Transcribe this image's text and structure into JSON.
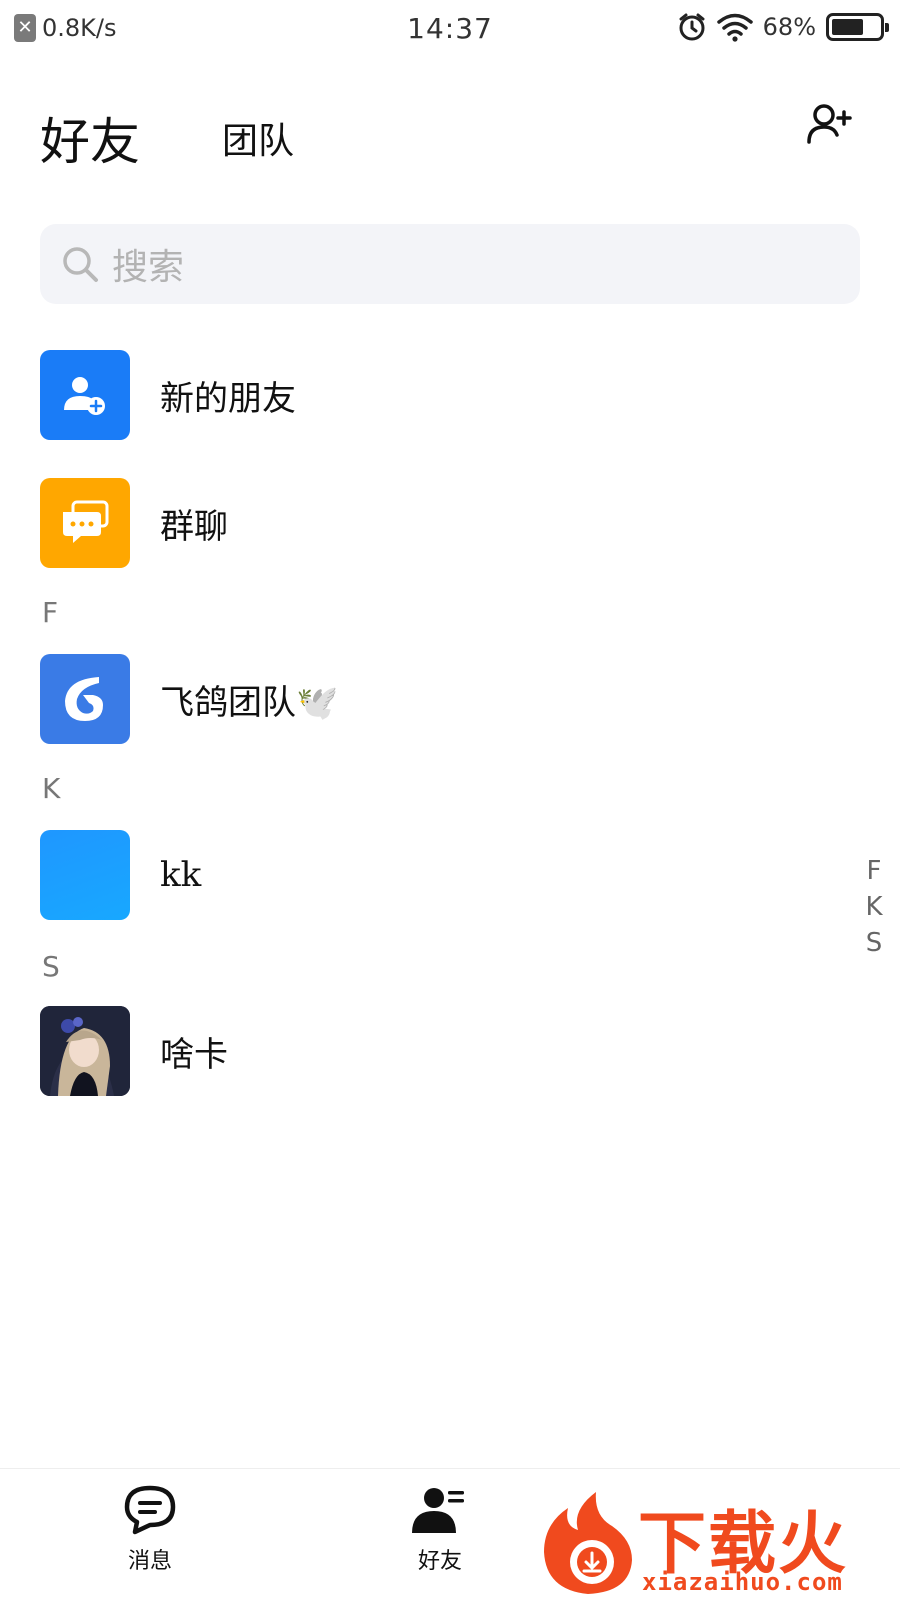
{
  "status_bar": {
    "network_speed": "0.8K/s",
    "close_glyph": "✕",
    "time": "14:37",
    "battery_percent": "68%",
    "battery_level": 0.68,
    "icons": [
      "alarm-icon",
      "wifi-icon",
      "battery-icon"
    ]
  },
  "header": {
    "tab_active": "好友",
    "tab_inactive": "团队",
    "add_friend_icon": "add-friend-icon"
  },
  "search": {
    "placeholder": "搜索",
    "icon": "search-icon"
  },
  "fixed_items": [
    {
      "label": "新的朋友",
      "icon": "new-friend-icon",
      "color": "#1a7cf7"
    },
    {
      "label": "群聊",
      "icon": "group-chat-icon",
      "color": "#ffa700"
    }
  ],
  "sections": [
    {
      "letter": "F",
      "contacts": [
        {
          "name": "飞鸽团队🕊️",
          "avatar": "feige-logo-icon",
          "color": "#3a7be6"
        }
      ]
    },
    {
      "letter": "K",
      "contacts": [
        {
          "name": "kk",
          "avatar": "blank-avatar",
          "color": "#1f97ff"
        }
      ]
    },
    {
      "letter": "S",
      "contacts": [
        {
          "name": "啥卡",
          "avatar": "anime-avatar"
        }
      ]
    }
  ],
  "index_bar": [
    "F",
    "K",
    "S"
  ],
  "bottom_nav": [
    {
      "label": "消息",
      "icon": "message-icon"
    },
    {
      "label": "好友",
      "icon": "friends-icon"
    }
  ],
  "watermark": {
    "text": "下载火",
    "url": "xiazaihuo.com",
    "color": "#f04a1e"
  }
}
